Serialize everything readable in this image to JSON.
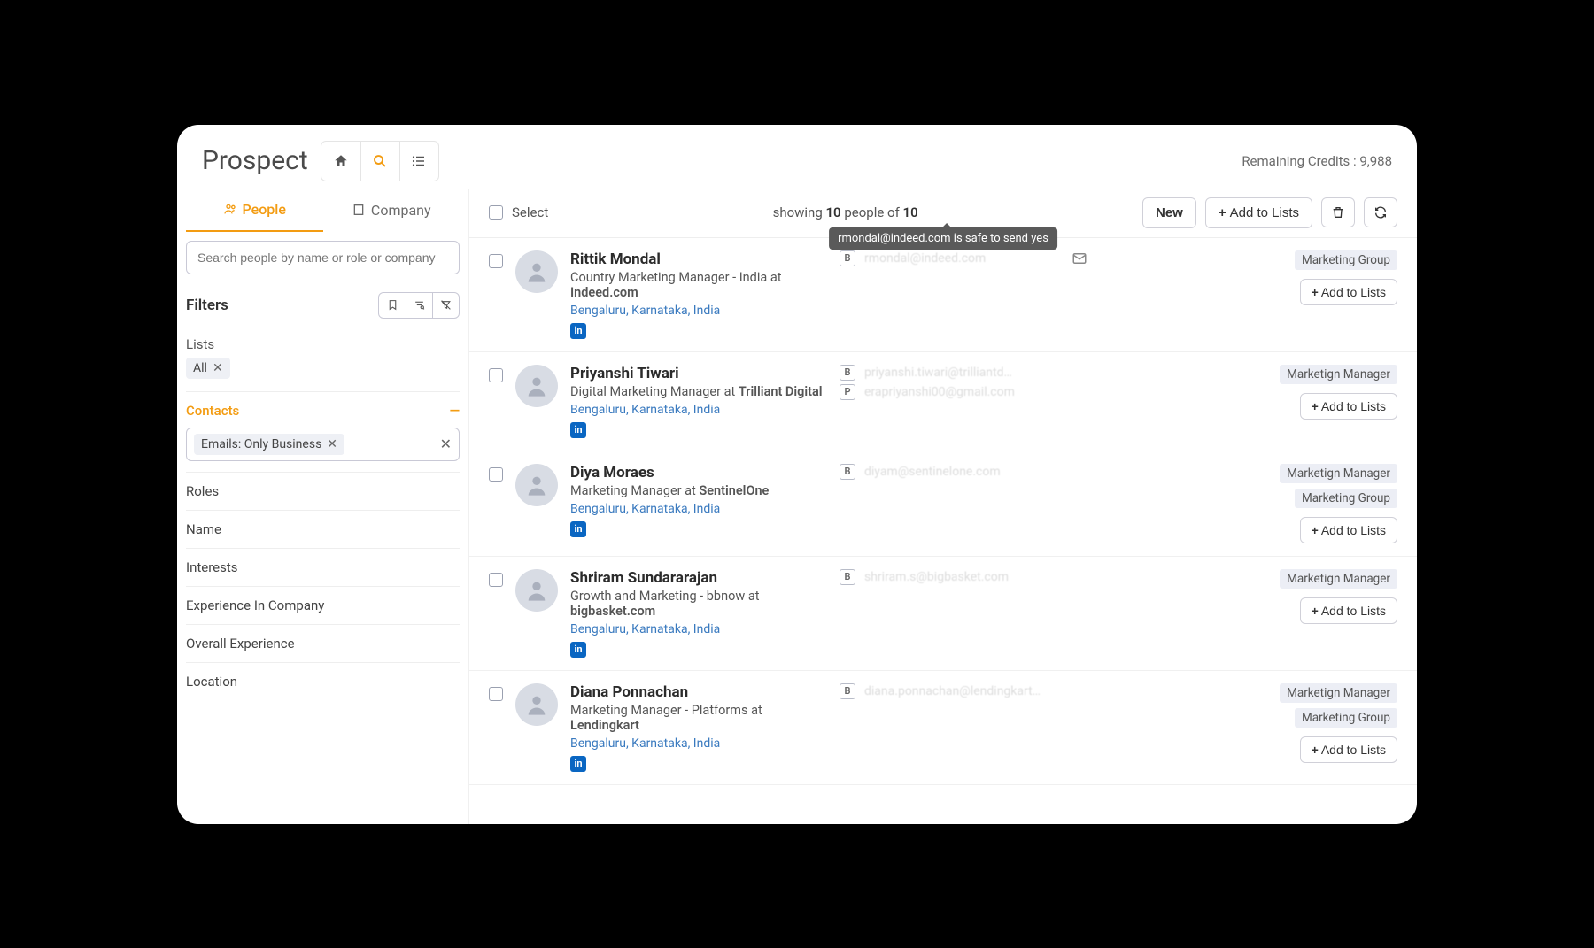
{
  "header": {
    "app_title": "Prospect",
    "credits_label": "Remaining Credits : 9,988"
  },
  "sidebar": {
    "tabs": {
      "people": "People",
      "company": "Company"
    },
    "search_placeholder": "Search people by name or role or company",
    "filters_label": "Filters",
    "lists_label": "Lists",
    "lists_chip": "All",
    "contacts_label": "Contacts",
    "contacts_chip": "Emails: Only Business",
    "groups": [
      "Roles",
      "Name",
      "Interests",
      "Experience In Company",
      "Overall Experience",
      "Location"
    ]
  },
  "toolbar": {
    "select_label": "Select",
    "showing_prefix": "showing ",
    "showing_count": "10",
    "showing_mid": " people of ",
    "showing_total": "10",
    "new_label": "New",
    "add_to_lists": "Add to Lists",
    "tooltip": "rmondal@indeed.com is safe to send yes"
  },
  "people": [
    {
      "name": "Rittik Mondal",
      "title_pre": "Country Marketing Manager - India at ",
      "company": "Indeed.com",
      "location": "Bengaluru, Karnataka, India",
      "emails": [
        {
          "type": "B",
          "value": "rmondal@indeed.com"
        }
      ],
      "show_mail_icon": true,
      "tags": [
        "Marketing Group"
      ],
      "add_label": "Add to Lists"
    },
    {
      "name": "Priyanshi Tiwari",
      "title_pre": "Digital Marketing Manager at ",
      "company": "Trilliant Digital",
      "location": "Bengaluru, Karnataka, India",
      "emails": [
        {
          "type": "B",
          "value": "priyanshi.tiwari@trilliantd…"
        },
        {
          "type": "P",
          "value": "erapriyanshi00@gmail.com"
        }
      ],
      "show_mail_icon": false,
      "tags": [
        "Marketign Manager"
      ],
      "add_label": "Add to Lists"
    },
    {
      "name": "Diya Moraes",
      "title_pre": "Marketing Manager at ",
      "company": "SentinelOne",
      "location": "Bengaluru, Karnataka, India",
      "emails": [
        {
          "type": "B",
          "value": "diyam@sentinelone.com"
        }
      ],
      "show_mail_icon": false,
      "tags": [
        "Marketign Manager",
        "Marketing Group"
      ],
      "add_label": "Add to Lists"
    },
    {
      "name": "Shriram Sundararajan",
      "title_pre": "Growth and Marketing - bbnow at ",
      "company": "bigbasket.com",
      "location": "Bengaluru, Karnataka, India",
      "emails": [
        {
          "type": "B",
          "value": "shriram.s@bigbasket.com"
        }
      ],
      "show_mail_icon": false,
      "tags": [
        "Marketign Manager"
      ],
      "add_label": "Add to Lists"
    },
    {
      "name": "Diana Ponnachan",
      "title_pre": "Marketing Manager - Platforms at ",
      "company": "Lendingkart",
      "location": "Bengaluru, Karnataka, India",
      "emails": [
        {
          "type": "B",
          "value": "diana.ponnachan@lendingkart…"
        }
      ],
      "show_mail_icon": false,
      "tags": [
        "Marketign Manager",
        "Marketing Group"
      ],
      "add_label": "Add to Lists"
    }
  ]
}
